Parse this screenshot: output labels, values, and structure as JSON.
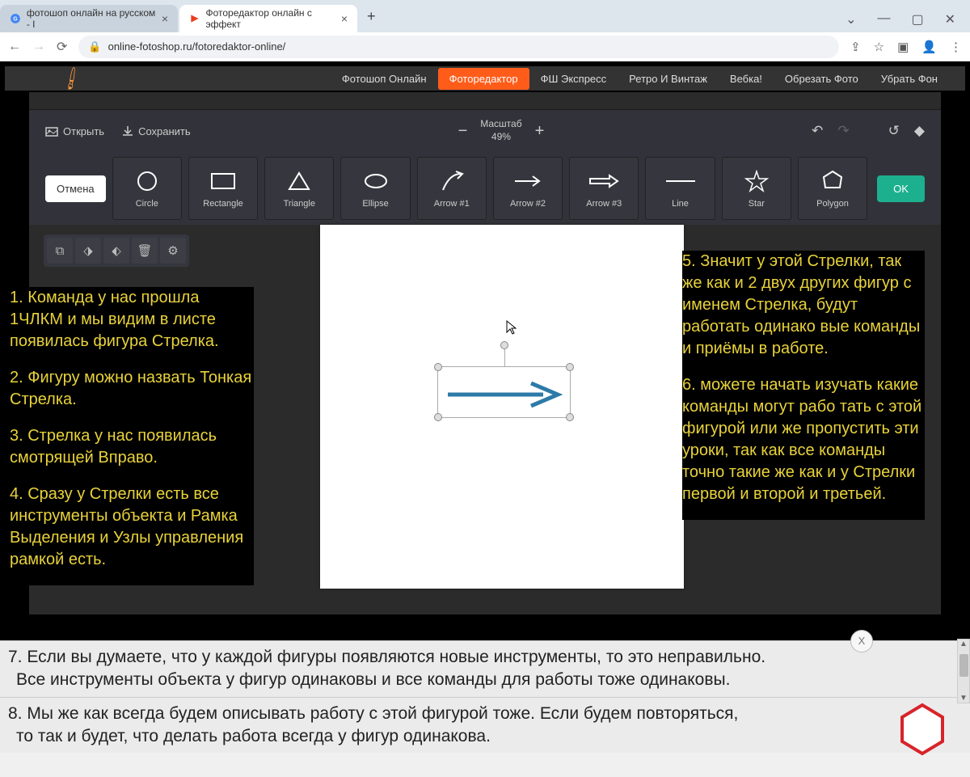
{
  "browser": {
    "tabs": [
      {
        "title": "фотошоп онлайн на русском - I"
      },
      {
        "title": "Фоторедактор онлайн с эффект"
      }
    ],
    "url": "online-fotoshop.ru/fotoredaktor-online/"
  },
  "nav": {
    "items": [
      "Фотошоп Онлайн",
      "Фоторедактор",
      "ФШ Экспресс",
      "Ретро И Винтаж",
      "Вебка!",
      "Обрезать Фото",
      "Убрать Фон"
    ],
    "active_index": 1
  },
  "actions": {
    "open": "Открыть",
    "save": "Сохранить",
    "zoom_label": "Масштаб",
    "zoom_value": "49%"
  },
  "shapes": {
    "cancel": "Отмена",
    "ok": "OK",
    "tiles": [
      "Circle",
      "Rectangle",
      "Triangle",
      "Ellipse",
      "Arrow #1",
      "Arrow #2",
      "Arrow #3",
      "Line",
      "Star",
      "Polygon"
    ]
  },
  "annotations": {
    "left": [
      "1. Команда у нас  прошла 1ЧЛКМ и мы видим в листе появилась фигура Стрелка.",
      "2. Фигуру можно назвать Тонкая Стрелка.",
      "3. Стрелка у нас появилась смотрящей Вправо.",
      "4. Сразу у Стрелки есть все инструменты объекта и Рамка Выделения и Узлы управления рамкой есть."
    ],
    "right": [
      "5. Значит у этой Стрелки, так же как и 2 двух других фигур с именем Стрелка, будут работать одинако вые команды и приёмы в работе.",
      "6. можете начать изучать какие команды могут рабо тать с этой фигурой или же пропустить эти уроки, так как все команды точно такие же как и у Стрелки первой и второй и третьей."
    ],
    "bottom1_line1": "7. Если вы думаете, что у каждой фигуры появляются новые инструменты, то это неправильно.",
    "bottom1_line2": "Все инструменты объекта у фигур одинаковы и все команды для работы тоже одинаковы.",
    "bottom2_line1": "8. Мы же как всегда будем описывать работу с этой фигурой тоже. Если будем повторяться,",
    "bottom2_line2": "то так и будет, что делать работа всегда у фигур одинакова.",
    "close_x": "X"
  }
}
